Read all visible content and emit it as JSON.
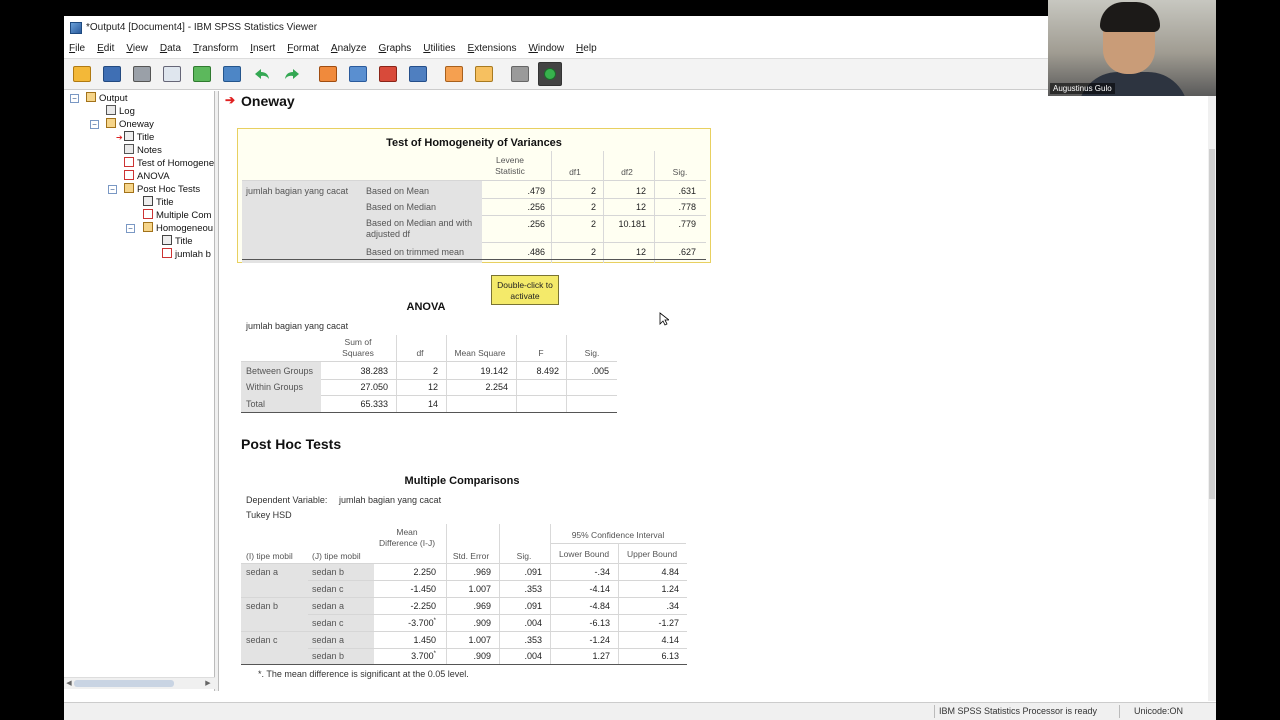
{
  "window": {
    "title": "*Output4 [Document4] - IBM SPSS Statistics Viewer"
  },
  "menu": [
    "File",
    "Edit",
    "View",
    "Data",
    "Transform",
    "Insert",
    "Format",
    "Analyze",
    "Graphs",
    "Utilities",
    "Extensions",
    "Window",
    "Help"
  ],
  "toolbar_icons": [
    "open-folder-icon",
    "save-icon",
    "print-icon",
    "print-preview-icon",
    "export-icon",
    "recall-dialog-icon",
    "undo-icon",
    "redo-icon",
    "goto-data-icon",
    "goto-case-icon",
    "goto-variable-icon",
    "variables-icon",
    "designate-window-icon",
    "script-icon",
    "show-all-icon",
    "insert-output-icon"
  ],
  "tree": {
    "output": "Output",
    "log": "Log",
    "oneway": "Oneway",
    "title1": "Title",
    "notes": "Notes",
    "homogeneity": "Test of Homogene",
    "anova": "ANOVA",
    "posthoc": "Post Hoc Tests",
    "title2": "Title",
    "multiple": "Multiple Com",
    "homogeneous": "Homogeneou",
    "title3": "Title",
    "jumlah": "jumlah b"
  },
  "oneway_heading": "Oneway",
  "levene": {
    "title": "Test of Homogeneity of Variances",
    "headers": {
      "statistic": "Levene Statistic",
      "df1": "df1",
      "df2": "df2",
      "sig": "Sig."
    },
    "variable": "jumlah bagian yang cacat",
    "rows": [
      {
        "label": "Based on Mean",
        "stat": ".479",
        "df1": "2",
        "df2": "12",
        "sig": ".631"
      },
      {
        "label": "Based on Median",
        "stat": ".256",
        "df1": "2",
        "df2": "12",
        "sig": ".778"
      },
      {
        "label": "Based on Median and with adjusted df",
        "stat": ".256",
        "df1": "2",
        "df2": "10.181",
        "sig": ".779"
      },
      {
        "label": "Based on trimmed mean",
        "stat": ".486",
        "df1": "2",
        "df2": "12",
        "sig": ".627"
      }
    ]
  },
  "tooltip": "Double-click to activate",
  "anova": {
    "title": "ANOVA",
    "subtitle": "jumlah bagian yang cacat",
    "headers": {
      "ss": "Sum of Squares",
      "df": "df",
      "ms": "Mean Square",
      "f": "F",
      "sig": "Sig."
    },
    "rows": [
      {
        "label": "Between Groups",
        "ss": "38.283",
        "df": "2",
        "ms": "19.142",
        "f": "8.492",
        "sig": ".005"
      },
      {
        "label": "Within Groups",
        "ss": "27.050",
        "df": "12",
        "ms": "2.254",
        "f": "",
        "sig": ""
      },
      {
        "label": "Total",
        "ss": "65.333",
        "df": "14",
        "ms": "",
        "f": "",
        "sig": ""
      }
    ]
  },
  "posthoc_heading": "Post Hoc Tests",
  "multiple": {
    "title": "Multiple Comparisons",
    "depvar_label": "Dependent Variable:",
    "depvar": "jumlah bagian yang cacat",
    "method": "Tukey HSD",
    "headers": {
      "i": "(I) tipe mobil",
      "j": "(J) tipe mobil",
      "md": "Mean Difference (I-J)",
      "se": "Std. Error",
      "sig": "Sig.",
      "ci": "95% Confidence Interval",
      "lb": "Lower Bound",
      "ub": "Upper Bound"
    },
    "rows": [
      {
        "i": "sedan a",
        "j": "sedan b",
        "md": "2.250",
        "star": "",
        "se": ".969",
        "sig": ".091",
        "lb": "-.34",
        "ub": "4.84"
      },
      {
        "i": "",
        "j": "sedan c",
        "md": "-1.450",
        "star": "",
        "se": "1.007",
        "sig": ".353",
        "lb": "-4.14",
        "ub": "1.24"
      },
      {
        "i": "sedan b",
        "j": "sedan a",
        "md": "-2.250",
        "star": "",
        "se": ".969",
        "sig": ".091",
        "lb": "-4.84",
        "ub": ".34"
      },
      {
        "i": "",
        "j": "sedan c",
        "md": "-3.700",
        "star": "*",
        "se": ".909",
        "sig": ".004",
        "lb": "-6.13",
        "ub": "-1.27"
      },
      {
        "i": "sedan c",
        "j": "sedan a",
        "md": "1.450",
        "star": "",
        "se": "1.007",
        "sig": ".353",
        "lb": "-1.24",
        "ub": "4.14"
      },
      {
        "i": "",
        "j": "sedan b",
        "md": "3.700",
        "star": "*",
        "se": ".909",
        "sig": ".004",
        "lb": "1.27",
        "ub": "6.13"
      }
    ],
    "footnote": "*. The mean difference is significant at the 0.05 level."
  },
  "status": {
    "processor": "IBM SPSS Statistics Processor is ready",
    "unicode": "Unicode:ON"
  },
  "webcam": {
    "name": "Augustinus Gulo"
  }
}
